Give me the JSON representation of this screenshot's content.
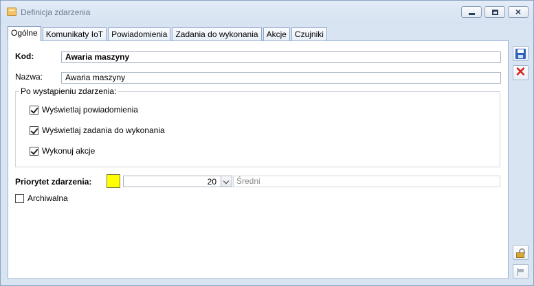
{
  "window": {
    "title": "Definicja zdarzenia",
    "close_glyph": "×"
  },
  "tabs": [
    {
      "label": "Ogólne",
      "active": true
    },
    {
      "label": "Komunikaty IoT"
    },
    {
      "label": "Powiadomienia"
    },
    {
      "label": "Zadania do wykonania"
    },
    {
      "label": "Akcje"
    },
    {
      "label": "Czujniki"
    }
  ],
  "form": {
    "kod_label": "Kod:",
    "kod_value": "Awaria maszyny",
    "nazwa_label": "Nazwa:",
    "nazwa_value": "Awaria maszyny",
    "group_title": "Po wystąpieniu zdarzenia:",
    "checkboxes": [
      {
        "label": "Wyświetlaj powiadomienia",
        "checked": true
      },
      {
        "label": "Wyświetlaj zadania do wykonania",
        "checked": true
      },
      {
        "label": "Wykonuj akcje",
        "checked": true
      }
    ],
    "priority_label": "Priorytet zdarzenia:",
    "priority_color": "#ffff00",
    "priority_value": "20",
    "priority_name": "Średni",
    "archive_label": "Archiwalna",
    "archive_checked": false
  },
  "toolbar": {
    "save_icon": "save-icon",
    "cancel_icon": "close-icon",
    "cancel_glyph": "✕",
    "lock_icon": "lock-icon",
    "flag_icon": "flag-icon"
  }
}
